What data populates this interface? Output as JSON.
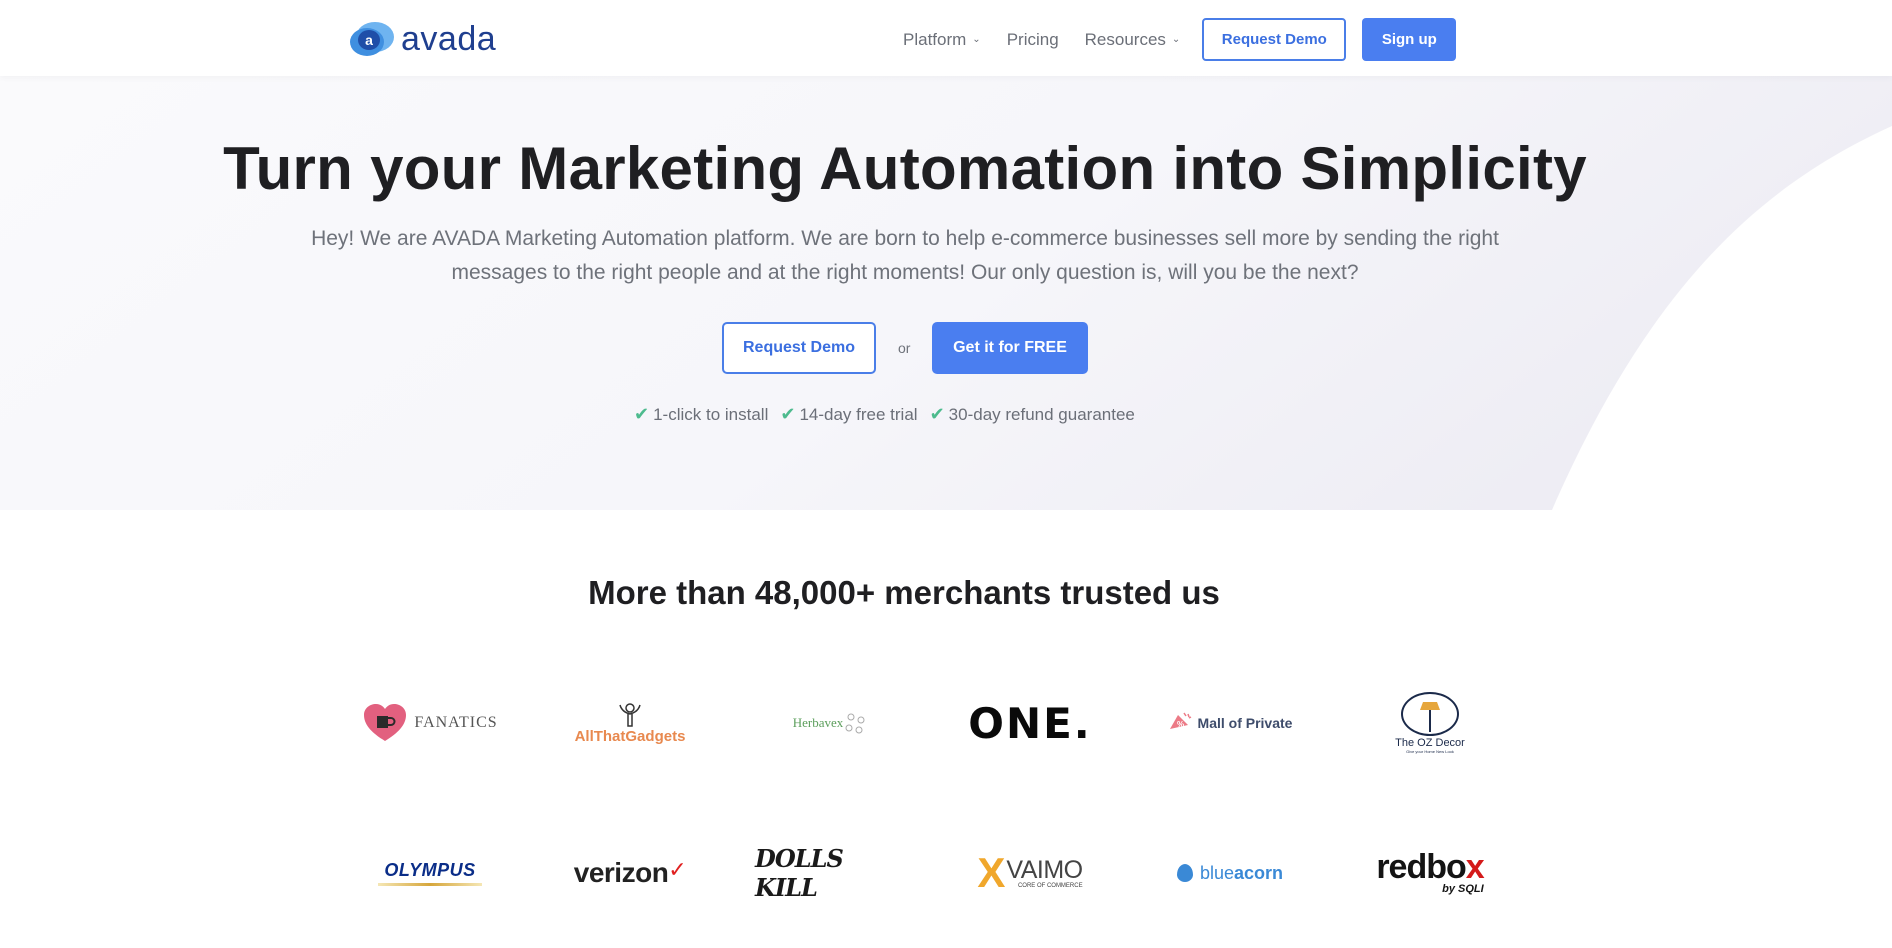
{
  "header": {
    "logo_text": "avada",
    "logo_letter": "a",
    "nav": [
      {
        "label": "Platform",
        "has_dropdown": true
      },
      {
        "label": "Pricing",
        "has_dropdown": false
      },
      {
        "label": "Resources",
        "has_dropdown": true
      }
    ],
    "request_demo_label": "Request Demo",
    "sign_up_label": "Sign up"
  },
  "hero": {
    "title": "Turn your Marketing Automation into Simplicity",
    "subtitle": "Hey! We are AVADA Marketing Automation platform. We are born to help e-commerce businesses sell more by sending the right messages to the right people and at the right moments! Our only question is, will you be the next?",
    "request_demo_label": "Request Demo",
    "or_label": "or",
    "get_free_label": "Get it for FREE",
    "features": [
      "1-click to install",
      "14-day free trial",
      "30-day refund guarantee"
    ],
    "check_icon": "✔"
  },
  "merchants": {
    "title": "More than 48,000+ merchants trusted us",
    "row1": [
      {
        "name": "FANATICS"
      },
      {
        "name": "AllThatGadgets"
      },
      {
        "name": "Herbavex"
      },
      {
        "name": "ONE."
      },
      {
        "name": "Mall of Private"
      },
      {
        "name": "The OZ Decor",
        "tagline": "Give your Home New Look"
      }
    ],
    "row2": [
      {
        "name": "OLYMPUS"
      },
      {
        "name": "verizon",
        "mark": "✓"
      },
      {
        "name": "DOLLS KILL"
      },
      {
        "name": "VAIMO",
        "tagline": "CORE OF COMMERCE",
        "mark": "X"
      },
      {
        "name_light": "blue",
        "name_bold": "acorn"
      },
      {
        "name_main": "redbo",
        "name_accent": "x",
        "tagline": "by SQLI"
      }
    ]
  },
  "colors": {
    "brand_blue": "#4a7ef0",
    "logo_navy": "#1f3f8f",
    "check_green": "#4dbb8e",
    "heading": "#1f1f22",
    "body_text": "#6e727a"
  }
}
